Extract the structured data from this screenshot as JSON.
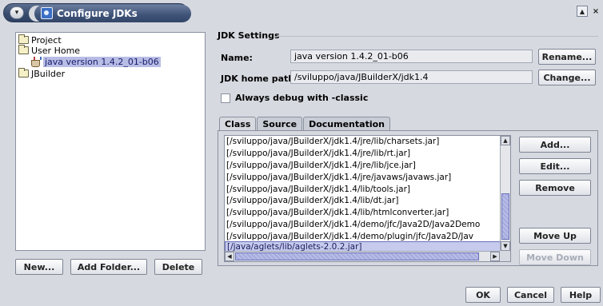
{
  "window": {
    "title": "Configure JDKs",
    "icons": {
      "system_menu": "chevron-down-icon",
      "app": "jdk-app-icon",
      "maximize": "maximize-icon",
      "close": "close-icon"
    },
    "system_menu_glyph": "▾",
    "maximize_glyph": "▲",
    "close_glyph": "×"
  },
  "tree": {
    "items": [
      {
        "label": "Project",
        "icon": "folder-icon"
      },
      {
        "label": "User Home",
        "icon": "folder-icon"
      },
      {
        "label": "java version 1.4.2_01-b06",
        "icon": "jdk-icon",
        "selected": true
      },
      {
        "label": "JBuilder",
        "icon": "folder-icon"
      }
    ]
  },
  "left_buttons": {
    "new": "New...",
    "add_folder": "Add Folder...",
    "delete": "Delete"
  },
  "jdk_settings": {
    "group_title": "JDK Settings",
    "name_label": "Name:",
    "name_value": "java version 1.4.2_01-b06",
    "rename_button": "Rename...",
    "home_path_label": "JDK home path:",
    "home_path_value": "/sviluppo/java/JBuilderX/jdk1.4",
    "change_button": "Change...",
    "always_debug_label": "Always debug with -classic",
    "always_debug_checked": false
  },
  "tabs": [
    {
      "label": "Class",
      "active": true
    },
    {
      "label": "Source",
      "active": false
    },
    {
      "label": "Documentation",
      "active": false
    }
  ],
  "class_list": {
    "items": [
      "[/sviluppo/java/JBuilderX/jdk1.4/jre/lib/charsets.jar]",
      "[/sviluppo/java/JBuilderX/jdk1.4/jre/lib/rt.jar]",
      "[/sviluppo/java/JBuilderX/jdk1.4/jre/lib/jce.jar]",
      "[/sviluppo/java/JBuilderX/jdk1.4/jre/javaws/javaws.jar]",
      "[/sviluppo/java/JBuilderX/jdk1.4/lib/tools.jar]",
      "[/sviluppo/java/JBuilderX/jdk1.4/lib/dt.jar]",
      "[/sviluppo/java/JBuilderX/jdk1.4/lib/htmlconverter.jar]",
      "[/sviluppo/java/JBuilderX/jdk1.4/demo/jfc/Java2D/Java2Demo",
      "[/sviluppo/java/JBuilderX/jdk1.4/demo/plugin/jfc/Java2D/Jav",
      "[/java/aglets/lib/aglets-2.0.2.jar]"
    ],
    "selected_index": 9,
    "arrows": {
      "up": "▲",
      "down": "▼",
      "left": "◀",
      "right": "▶"
    }
  },
  "list_buttons": {
    "add": "Add...",
    "edit": "Edit...",
    "remove": "Remove",
    "move_up": "Move Up",
    "move_down": "Move Down"
  },
  "dialog_buttons": {
    "ok": "OK",
    "cancel": "Cancel",
    "help": "Help"
  }
}
